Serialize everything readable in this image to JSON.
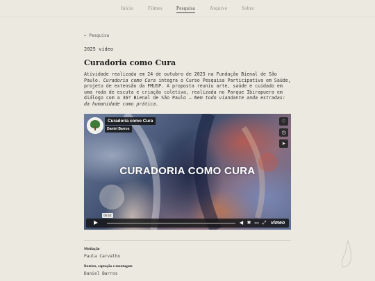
{
  "nav": {
    "items": [
      {
        "label": "Início",
        "active": false
      },
      {
        "label": "Filmes",
        "active": false
      },
      {
        "label": "Pesquisa",
        "active": true
      },
      {
        "label": "Arquivo",
        "active": false
      },
      {
        "label": "Sobre",
        "active": false
      }
    ]
  },
  "back_link": "← Pesquisa",
  "meta": "2025 vídeo",
  "title": "Curadoria como Cura",
  "description": {
    "p1": "Atividade realizada em 24 de outubro de 2025 na Fundação Bienal de São Paulo. ",
    "p1_em": "Curadoria como Cura",
    "p2": " integra o Curso Pesquisa Participativa em Saúde, projeto de extensão da FMUSP. A proposta reuniu arte, saúde e cuidado em uma roda de escuta e criação coletiva, realizada no Parque Ibirapuera em diálogo com a 36ª Bienal de São Paulo — ",
    "p2_em": "Nem todo viandante anda estradas: da humanidade como prática."
  },
  "video": {
    "overlay_title": "CURADORIA COMO CURA",
    "video_title": "Curadoria como Cura",
    "author": "Daniel Barros",
    "time": "05:52",
    "progress": 0.0,
    "brand": "vimeo",
    "side_icons": [
      "heart-icon",
      "clock-icon",
      "send-icon"
    ]
  },
  "credits": [
    {
      "label": "Mediação",
      "value": "Paula Carvalho"
    },
    {
      "label": "Roteiro, captação e montagem",
      "value": "Daniel Barros"
    }
  ],
  "colors": {
    "background": "#eceae0",
    "text": "#2b2b2b",
    "nav_inactive": "#8c8a80"
  }
}
